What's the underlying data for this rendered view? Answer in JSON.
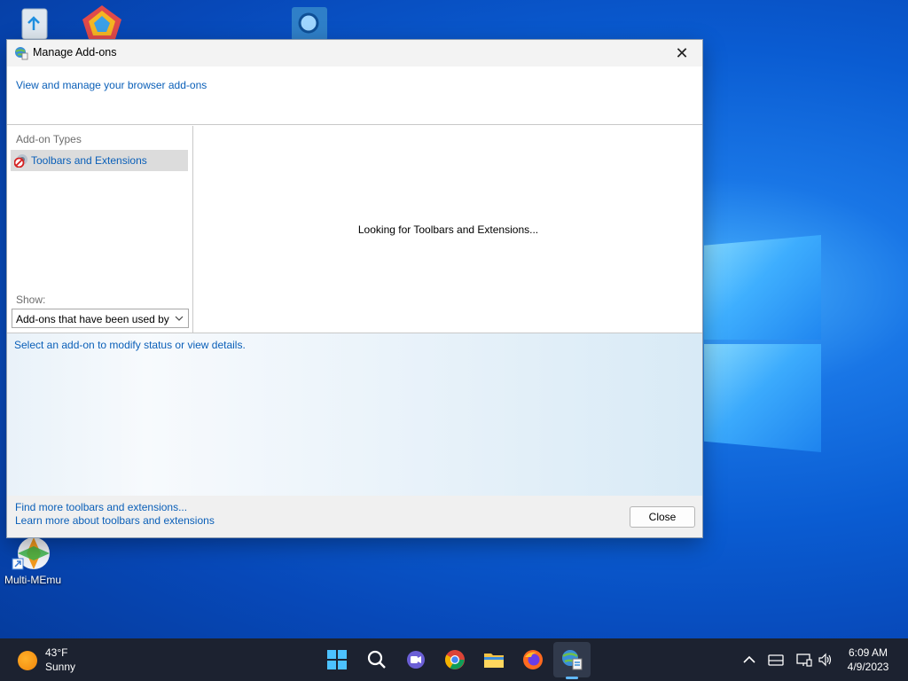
{
  "desktop": {
    "icons": [
      {
        "name": "recycle-bin-icon"
      },
      {
        "name": "app-icon"
      },
      {
        "name": "search-app-icon"
      },
      {
        "name": "multi-memu-icon",
        "label": "Multi-MEmu"
      }
    ]
  },
  "dialog": {
    "title": "Manage Add-ons",
    "header_link": "View and manage your browser add-ons",
    "addon_types_label": "Add-on Types",
    "addon_types": [
      {
        "label": "Toolbars and Extensions",
        "icon": "toolbar-extension-icon",
        "selected": true
      }
    ],
    "show_label": "Show:",
    "show_value": "Add-ons that have been used by your browser",
    "status_message": "Looking for Toolbars and Extensions...",
    "details_message": "Select an add-on to modify status or view details.",
    "footer_link_1": "Find more toolbars and extensions...",
    "footer_link_2": "Learn more about toolbars and extensions",
    "close_button": "Close"
  },
  "taskbar": {
    "weather_temp": "43°F",
    "weather_condition": "Sunny",
    "pinned": [
      "start-icon",
      "search-icon",
      "teams-chat-icon",
      "chrome-icon",
      "file-explorer-icon",
      "firefox-icon",
      "internet-options-icon"
    ],
    "active_app": "internet-options-icon",
    "tray": [
      "chevron-up-icon",
      "keyboard-icon",
      "network-icon",
      "volume-icon"
    ],
    "time": "6:09 AM",
    "date": "4/9/2023"
  },
  "colors": {
    "link_blue": "#0a5fb8",
    "taskbar_bg": "#1c2230",
    "desktop_blue": "#0a5cd2"
  }
}
